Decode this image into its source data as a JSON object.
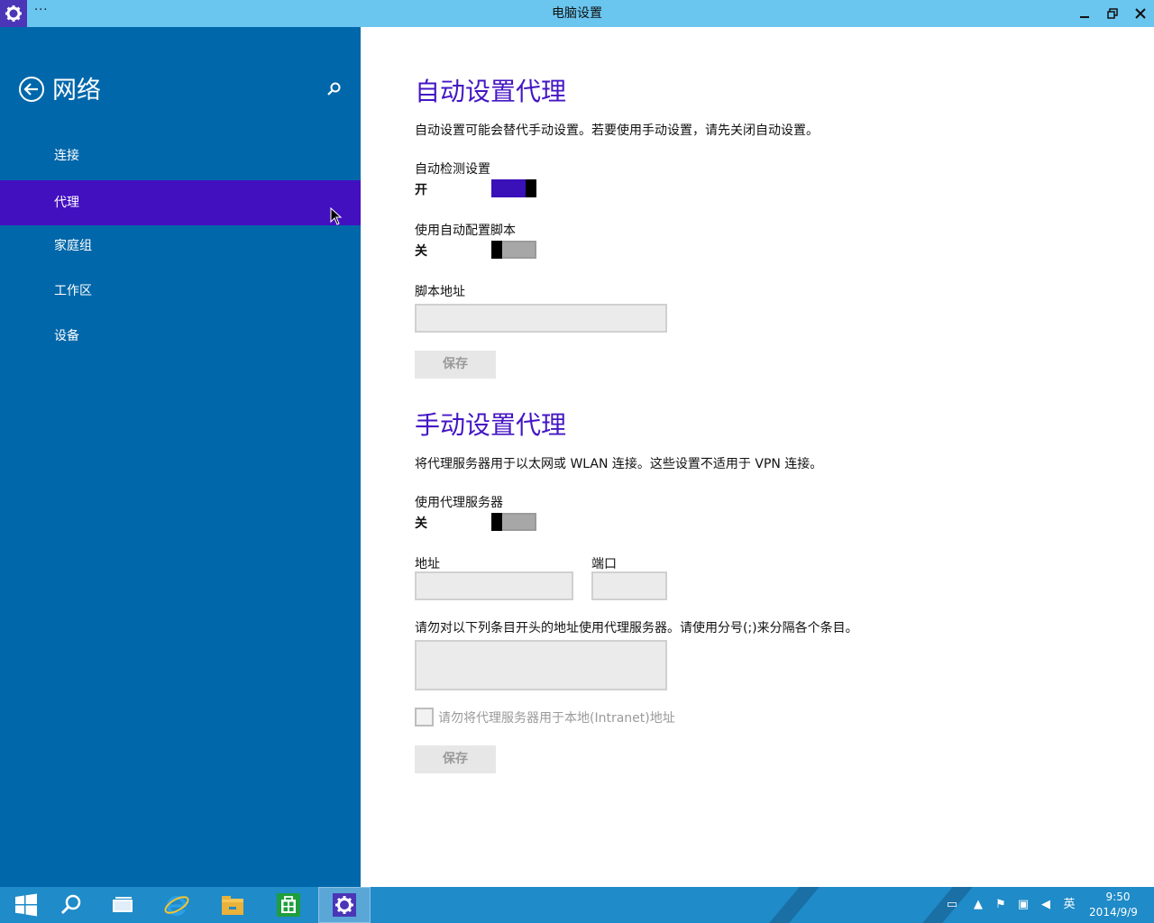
{
  "window": {
    "title": "电脑设置",
    "menu_glyph": "···"
  },
  "sidebar": {
    "title": "网络",
    "items": [
      {
        "label": "连接"
      },
      {
        "label": "代理"
      },
      {
        "label": "家庭组"
      },
      {
        "label": "工作区"
      },
      {
        "label": "设备"
      }
    ],
    "active_index": 1
  },
  "auto_proxy": {
    "title": "自动设置代理",
    "description": "自动设置可能会替代手动设置。若要使用手动设置，请先关闭自动设置。",
    "detect": {
      "label": "自动检测设置",
      "state": "开",
      "on": true
    },
    "script": {
      "label": "使用自动配置脚本",
      "state": "关",
      "on": false
    },
    "script_address": {
      "label": "脚本地址",
      "value": ""
    },
    "save_label": "保存"
  },
  "manual_proxy": {
    "title": "手动设置代理",
    "description": "将代理服务器用于以太网或 WLAN 连接。这些设置不适用于 VPN 连接。",
    "use_proxy": {
      "label": "使用代理服务器",
      "state": "关",
      "on": false
    },
    "address": {
      "label": "地址",
      "value": ""
    },
    "port": {
      "label": "端口",
      "value": ""
    },
    "exceptions": {
      "label": "请勿对以下列条目开头的地址使用代理服务器。请使用分号(;)来分隔各个条目。",
      "value": ""
    },
    "local_checkbox": {
      "label": "请勿将代理服务器用于本地(Intranet)地址",
      "checked": false
    },
    "save_label": "保存"
  },
  "taskbar": {
    "items": [
      "start-button",
      "search-icon",
      "task-view-icon",
      "internet-explorer-icon",
      "file-explorer-icon",
      "store-icon",
      "settings-icon"
    ],
    "tray": {
      "ime": "英",
      "time": "9:50",
      "date": "2014/9/9"
    }
  },
  "colors": {
    "titlebar": "#6ac5ef",
    "sidebar": "#0067aa",
    "accent": "#4310c0",
    "section_title": "#4416c4",
    "taskbar": "#1f8bc8"
  }
}
